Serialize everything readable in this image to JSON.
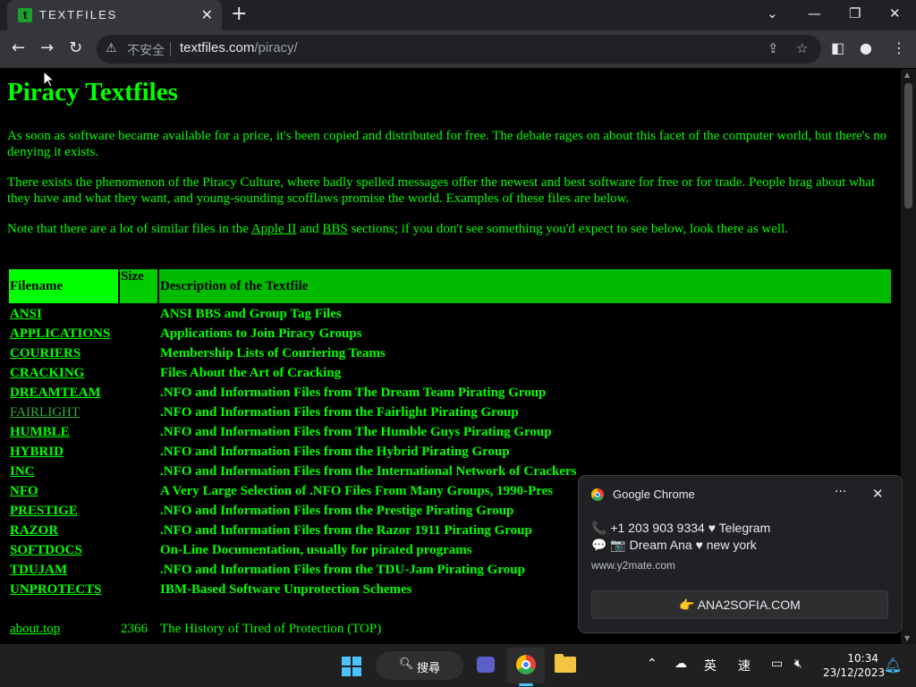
{
  "browser": {
    "tab_title": "TEXTFILES",
    "tab_favicon_letter": "t",
    "security_label": "不安全",
    "url_host": "textfiles.com",
    "url_path": "/piracy/"
  },
  "page": {
    "title": "Piracy Textfiles",
    "para1": "As soon as software became available for a price, it's been copied and distributed for free. The debate rages on about this facet of the computer world, but there's no denying it exists.",
    "para2": "There exists the phenomenon of the Piracy Culture, where badly spelled messages offer the newest and best software for free or for trade. People brag about what they have and what they want, and young-sounding scofflaws promise the world. Examples of these files are below.",
    "para3_before": "Note that there are a lot of similar files in the ",
    "para3_link1": "Apple II",
    "para3_mid": " and ",
    "para3_link2": "BBS",
    "para3_after": " sections; if you don't see something you'd expect to see below, look there as well.",
    "table": {
      "headers": [
        "Filename",
        "Size",
        "Description of the Textfile"
      ],
      "dirs": [
        {
          "name": "ANSI",
          "desc": "ANSI BBS and Group Tag Files"
        },
        {
          "name": "APPLICATIONS",
          "desc": "Applications to Join Piracy Groups"
        },
        {
          "name": "COURIERS",
          "desc": "Membership Lists of Couriering Teams"
        },
        {
          "name": "CRACKING",
          "desc": "Files About the Art of Cracking"
        },
        {
          "name": "DREAMTEAM",
          "desc": ".NFO and Information Files from The Dream Team Pirating Group"
        },
        {
          "name": "FAIRLIGHT",
          "desc": ".NFO and Information Files from the Fairlight Pirating Group"
        },
        {
          "name": "HUMBLE",
          "desc": ".NFO and Information Files from The Humble Guys Pirating Group"
        },
        {
          "name": "HYBRID",
          "desc": ".NFO and Information Files from the Hybrid Pirating Group"
        },
        {
          "name": "INC",
          "desc": ".NFO and Information Files from the International Network of Crackers"
        },
        {
          "name": "NFO",
          "desc": "A Very Large Selection of .NFO Files From Many Groups, 1990-Pres"
        },
        {
          "name": "PRESTIGE",
          "desc": ".NFO and Information Files from the Prestige Pirating Group"
        },
        {
          "name": "RAZOR",
          "desc": ".NFO and Information Files from the Razor 1911 Pirating Group"
        },
        {
          "name": "SOFTDOCS",
          "desc": "On-Line Documentation, usually for pirated programs"
        },
        {
          "name": "TDUJAM",
          "desc": ".NFO and Information Files from the TDU-Jam Pirating Group"
        },
        {
          "name": "UNPROTECTS",
          "desc": "IBM-Based Software Unprotection Schemes"
        }
      ],
      "files": [
        {
          "name": "about.top",
          "size": "2366",
          "desc": "The History of Tired of Protection (TOP)"
        }
      ]
    }
  },
  "notification": {
    "app": "Google Chrome",
    "line1": "📞 +1 203 903 9334 ♥ Telegram",
    "line2": "💬 📷 Dream Ana ♥ new york",
    "source": "www.y2mate.com",
    "button": "👉 ANA2SOFIA.COM"
  },
  "taskbar": {
    "search_label": "搜尋",
    "ime1": "英",
    "ime2": "速",
    "time": "10:34",
    "date": "23/12/2023"
  },
  "colors": {
    "page_bg": "#000000",
    "text_green": "#00ff00",
    "header_green": "#00ff00"
  }
}
